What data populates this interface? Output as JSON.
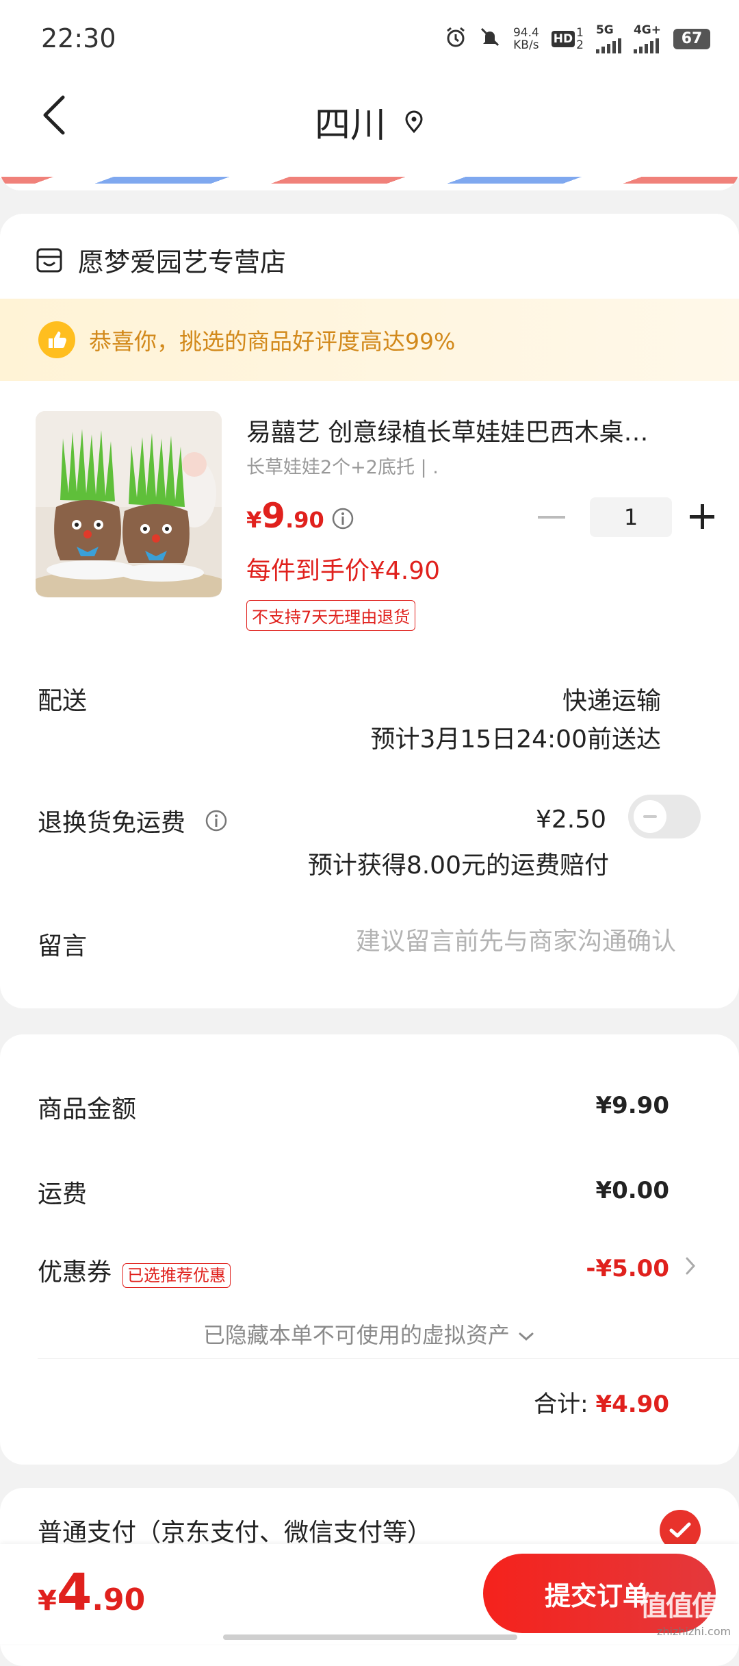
{
  "status_bar": {
    "time": "22:30",
    "net_speed_value": "94.4",
    "net_speed_unit": "KB/s",
    "hd_label": "HD",
    "sim1_label": "1",
    "sim2_label": "2",
    "network_5g": "5G",
    "network_4g": "4G+",
    "battery": "67"
  },
  "header": {
    "title": "四川"
  },
  "store": {
    "name": "愿梦爱园艺专营店"
  },
  "promo": {
    "text": "恭喜你，挑选的商品好评度高达99%"
  },
  "product": {
    "title": "易囍艺 创意绿植长草娃娃巴西木桌…",
    "spec": "长草娃娃2个+2底托 | .",
    "price_currency": "¥",
    "price_int": "9",
    "price_dec": ".90",
    "quantity": "1",
    "hand_price": "每件到手价¥4.90",
    "no_return_tag": "不支持7天无理由退货"
  },
  "delivery": {
    "label": "配送",
    "method": "快递运输",
    "eta": "预计3月15日24:00前送达"
  },
  "return_shipping": {
    "label": "退换货免运费",
    "price": "¥2.50",
    "compensation": "预计获得8.00元的运费赔付",
    "enabled": false
  },
  "message": {
    "label": "留言",
    "placeholder": "建议留言前先与商家沟通确认"
  },
  "summary": {
    "goods_label": "商品金额",
    "goods_value": "¥9.90",
    "shipping_label": "运费",
    "shipping_value": "¥0.00",
    "coupon_label": "优惠券",
    "coupon_tag": "已选推荐优惠",
    "coupon_value": "-¥5.00",
    "hidden_assets": "已隐藏本单不可使用的虚拟资产",
    "total_label": "合计:",
    "total_value": "¥4.90"
  },
  "payment": {
    "label": "普通支付（京东支付、微信支付等）",
    "selected": true
  },
  "bottom_bar": {
    "price_currency": "¥",
    "price_int": "4",
    "price_dec": ".90",
    "submit_label": "提交订单"
  },
  "watermark": {
    "text": "值值值",
    "sub": "zhizhizhi.com"
  },
  "colors": {
    "accent_red": "#e0211d",
    "promo_text": "#d2891b",
    "promo_icon": "#ffbe1f"
  }
}
